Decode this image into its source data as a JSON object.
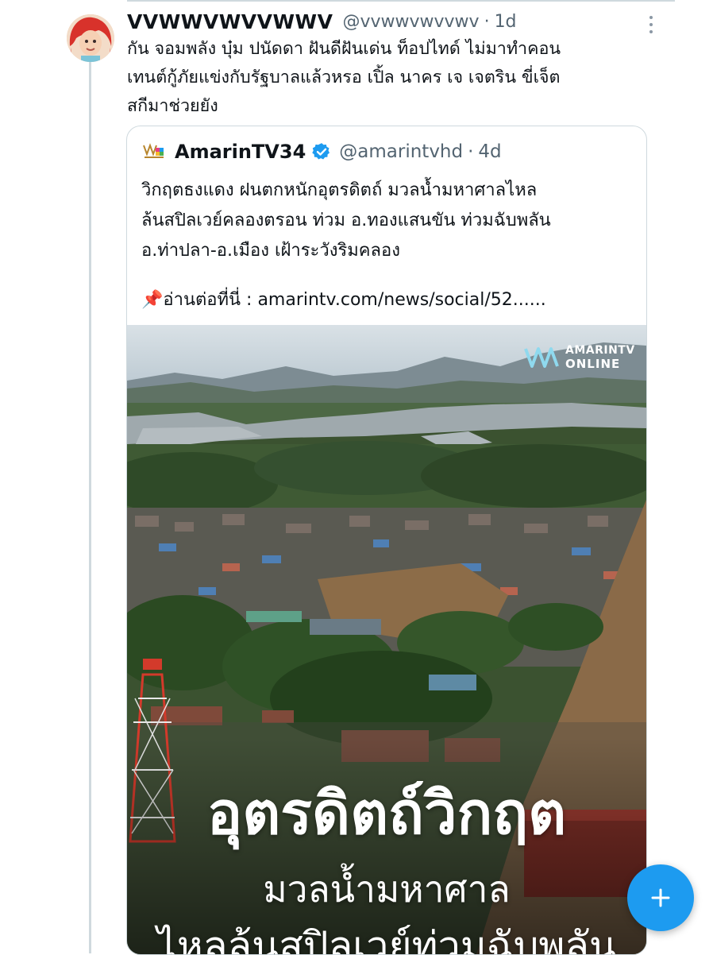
{
  "tweet": {
    "display_name": "VVWWVWVVWWV",
    "handle": "@vvwwvwvvwv",
    "time": "1d",
    "text": "กัน จอมพลัง บุ๋ม ปนัดดา ฝันดีฝันเด่น ท็อปไทด์ ไม่มาทำคอน\nเทนต์กู้ภัยแข่งกับรัฐบาลแล้วหรอ เปิ้ล นาคร เจ เจตริน ขี่เจ็ต\nสกีมาช่วยยัง"
  },
  "quote": {
    "display_name": "AmarinTV34",
    "handle": "@amarintvhd",
    "time": "4d",
    "text": "วิกฤตธงแดง ฝนตกหนักอุตรดิตถ์ มวลน้ำมหาศาลไหล\nล้นสปิลเวย์คลองตรอน ท่วม อ.ทองแสนขัน ท่วมฉับพลัน\nอ.ท่าปลา-อ.เมือง เฝ้าระวังริมคลอง",
    "link_prefix": "📌อ่านต่อที่นี่ : ",
    "link": "amarintv.com/news/social/52......",
    "image": {
      "watermark_line1": "AMARINTV",
      "watermark_line2": "ONLINE",
      "headline1": "อุตรดิตถ์วิกฤต",
      "headline2": "มวลน้ำมหาศาล",
      "headline3": "ไหลล้นสปิลเวย์ท่วมฉับพลัน"
    }
  },
  "icons": {
    "more": "more-icon",
    "verified": "verified-badge-icon",
    "compose": "plus-icon"
  },
  "colors": {
    "accent": "#1d9bf0",
    "secondary_text": "#536471",
    "border": "#cfd9de"
  }
}
